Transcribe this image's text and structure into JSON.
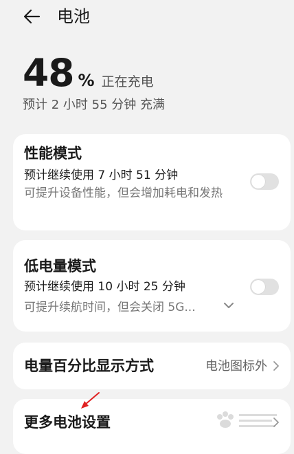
{
  "header": {
    "back_icon": "arrow-left-icon",
    "title": "电池"
  },
  "battery": {
    "level_value": "48",
    "level_unit": "%",
    "charging_status": "正在充电",
    "eta_text": "预计 2 小时 55 分钟 充满"
  },
  "performance_mode": {
    "title": "性能模式",
    "estimate": "预计继续使用 7 小时 51 分钟",
    "description": "可提升设备性能，但会增加耗电和发热",
    "enabled": false
  },
  "low_power_mode": {
    "title": "低电量模式",
    "estimate": "预计继续使用 10 小时 25 分钟",
    "description": "可提升续航时间，但会关闭 5G...",
    "enabled": false,
    "expand_icon": "chevron-down-icon"
  },
  "percentage_display": {
    "title": "电量百分比显示方式",
    "value": "电池图标外"
  },
  "more_settings": {
    "title": "更多电池设置"
  },
  "colors": {
    "background": "#f2f2f2",
    "card": "#ffffff",
    "toggle_off": "#e1e1e1",
    "annotation_arrow": "#e02020"
  }
}
